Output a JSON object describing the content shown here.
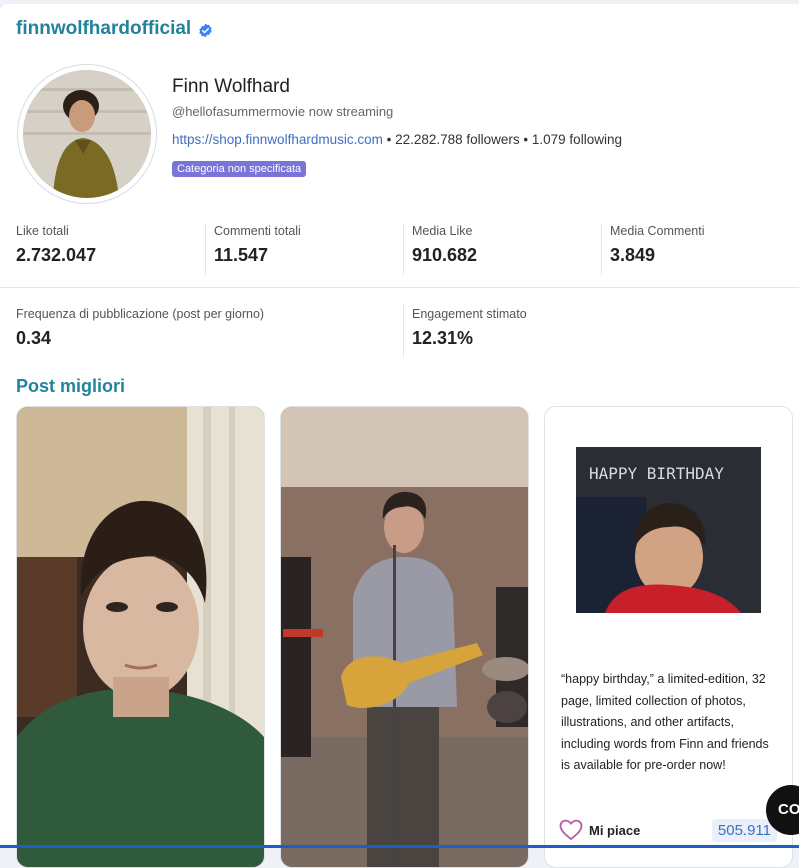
{
  "profile": {
    "username": "finnwolfhardofficial",
    "full_name": "Finn Wolfhard",
    "bio": "@hellofasummermovie now streaming",
    "website": "https://shop.finnwolfhardmusic.com",
    "followers_text": " • 22.282.788 followers • 1.079 following",
    "category_badge": "Categoria non specificata"
  },
  "stats_row1": [
    {
      "label": "Like totali",
      "value": "2.732.047"
    },
    {
      "label": "Commenti totali",
      "value": "11.547"
    },
    {
      "label": "Media Like",
      "value": "910.682"
    },
    {
      "label": "Media Commenti",
      "value": "3.849"
    }
  ],
  "stats_row2": [
    {
      "label": "Frequenza di pubblicazione (post per giorno)",
      "value": "0.34"
    },
    {
      "label": "Engagement stimato",
      "value": "12.31%"
    }
  ],
  "top_posts": {
    "title": "Post migliori",
    "post3": {
      "image_text": "HAPPY BIRTHDAY",
      "caption": "“happy birthday,” a limited-edition, 32 page, limited collection of photos, illustrations, and other artifacts, including words from Finn and friends is available for pre-order now!",
      "likes_label": "Mi piace",
      "likes_count": "505.911"
    }
  },
  "fab_label": "CO",
  "colors": {
    "accent": "#22839a",
    "link": "#3d6fc4",
    "badge": "#7b74d8",
    "verified": "#3b82f6"
  },
  "icons": [
    "verified-badge-icon",
    "heart-icon"
  ]
}
